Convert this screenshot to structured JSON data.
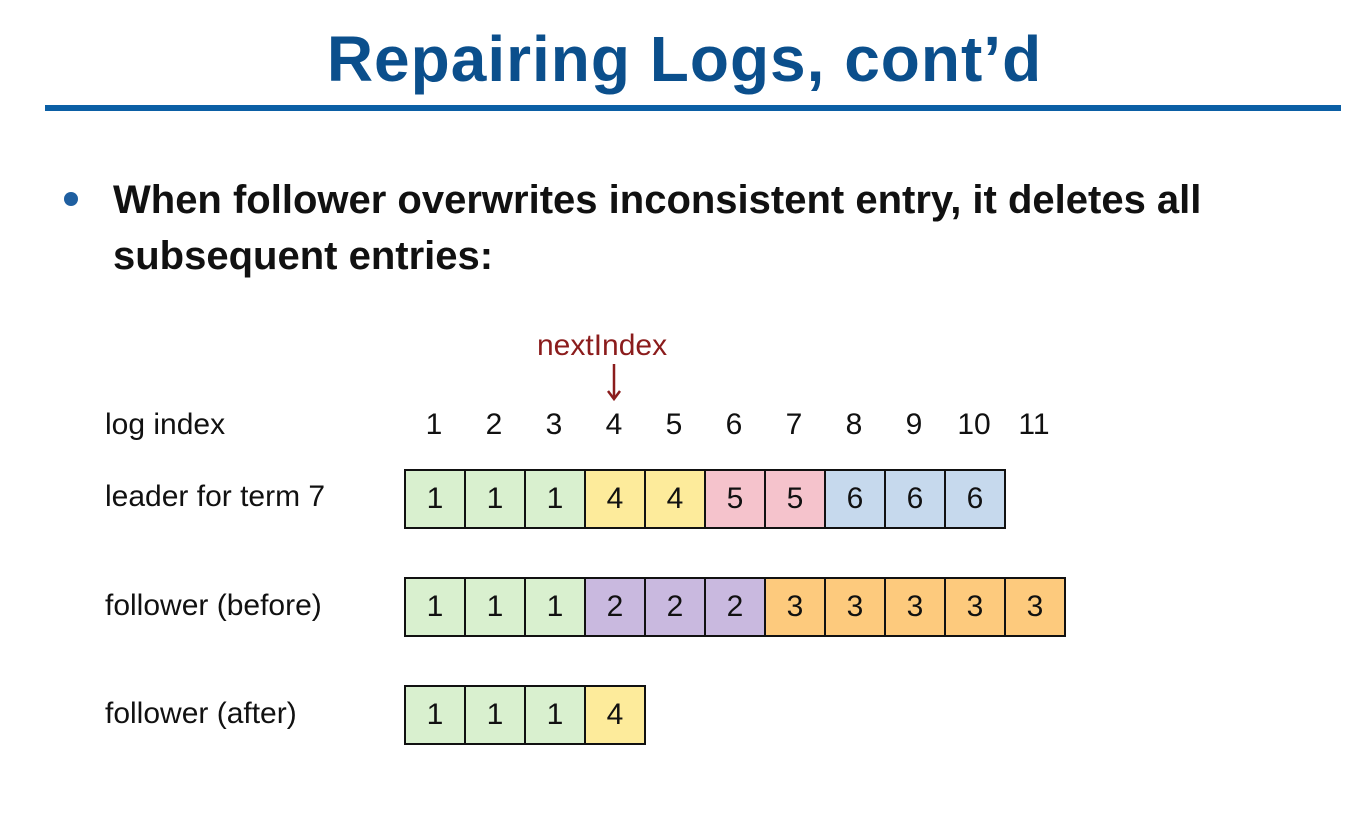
{
  "title": "Repairing Logs, cont’d",
  "bullet": "When follower overwrites inconsistent entry, it deletes all subsequent entries:",
  "next_index_label": "nextIndex",
  "rows": {
    "index_label": "log index",
    "indices": [
      "1",
      "2",
      "3",
      "4",
      "5",
      "6",
      "7",
      "8",
      "9",
      "10",
      "11"
    ],
    "leader_label": "leader for term 7",
    "leader": [
      "1",
      "1",
      "1",
      "4",
      "4",
      "5",
      "5",
      "6",
      "6",
      "6"
    ],
    "before_label": "follower (before)",
    "before": [
      "1",
      "1",
      "1",
      "2",
      "2",
      "2",
      "3",
      "3",
      "3",
      "3",
      "3"
    ],
    "after_label": "follower (after)",
    "after": [
      "1",
      "1",
      "1",
      "4"
    ]
  },
  "term_colors": {
    "1": "#d9f0cf",
    "2": "#c9b9df",
    "3": "#fdca7d",
    "4": "#fdeb9b",
    "5": "#f5c3cc",
    "6": "#c6d9ed"
  }
}
